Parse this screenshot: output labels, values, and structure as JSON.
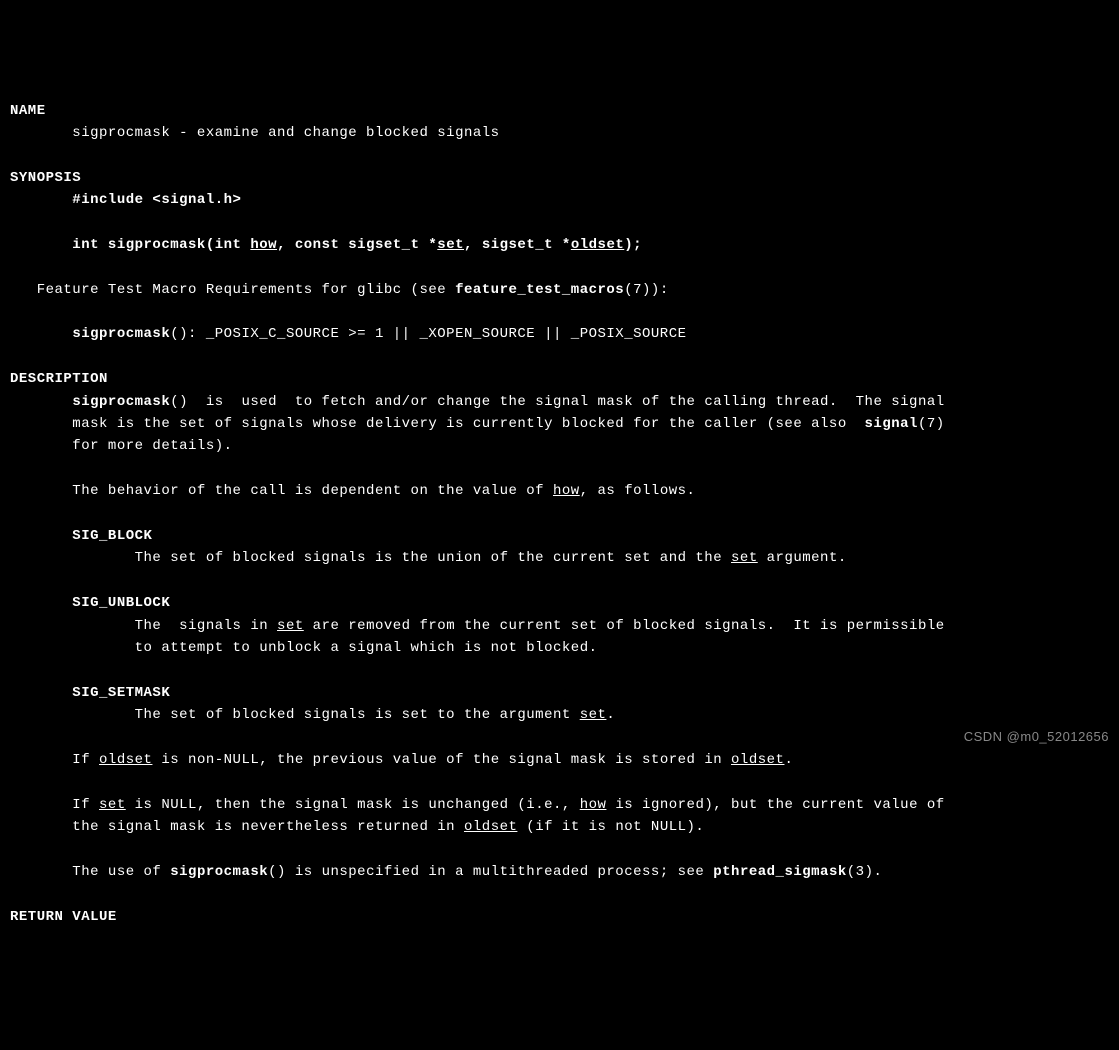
{
  "sections": {
    "name": {
      "header": "NAME",
      "line1": "       sigprocmask - examine and change blocked signals"
    },
    "synopsis": {
      "header": "SYNOPSIS",
      "include": "       #include <signal.h>",
      "decl_pre": "       int sigprocmask(int ",
      "decl_how": "how",
      "decl_mid1": ", const sigset_t *",
      "decl_set": "set",
      "decl_mid2": ", sigset_t *",
      "decl_oldset": "oldset",
      "decl_post": ");",
      "feature_line_pre": "   Feature Test Macro Requirements for glibc (see ",
      "feature_line_bold": "feature_test_macros",
      "feature_line_post": "(7)):",
      "ftm_pre": "       ",
      "ftm_bold": "sigprocmask",
      "ftm_post": "(): _POSIX_C_SOURCE >= 1 || _XOPEN_SOURCE || _POSIX_SOURCE"
    },
    "description": {
      "header": "DESCRIPTION",
      "p1_pre": "       ",
      "p1_bold1": "sigprocmask",
      "p1_mid1": "()  is  used  to fetch and/or change the signal mask of the calling thread.  The signal\n       mask is the set of signals whose delivery is currently blocked for the caller (see also  ",
      "p1_bold2": "signal",
      "p1_post": "(7)\n       for more details).",
      "p2_pre": "       The behavior of the call is dependent on the value of ",
      "p2_how": "how",
      "p2_post": ", as follows.",
      "sigblock_header": "       SIG_BLOCK",
      "sigblock_body_pre": "              The set of blocked signals is the union of the current set and the ",
      "sigblock_set": "set",
      "sigblock_body_post": " argument.",
      "sigunblock_header": "       SIG_UNBLOCK",
      "sigunblock_body_pre": "              The  signals in ",
      "sigunblock_set": "set",
      "sigunblock_body_post": " are removed from the current set of blocked signals.  It is permissible\n              to attempt to unblock a signal which is not blocked.",
      "sigsetmask_header": "       SIG_SETMASK",
      "sigsetmask_body_pre": "              The set of blocked signals is set to the argument ",
      "sigsetmask_set": "set",
      "sigsetmask_body_post": ".",
      "p3_pre": "       If ",
      "p3_oldset1": "oldset",
      "p3_mid": " is non-NULL, the previous value of the signal mask is stored in ",
      "p3_oldset2": "oldset",
      "p3_post": ".",
      "p4_pre": "       If ",
      "p4_set": "set",
      "p4_mid1": " is NULL, then the signal mask is unchanged (i.e., ",
      "p4_how": "how",
      "p4_mid2": " is ignored), but the current value of\n       the signal mask is nevertheless returned in ",
      "p4_oldset": "oldset",
      "p4_post": " (if it is not NULL).",
      "p5_pre": "       The use of ",
      "p5_bold1": "sigprocmask",
      "p5_mid": "() is unspecified in a multithreaded process; see ",
      "p5_bold2": "pthread_sigmask",
      "p5_post": "(3)."
    },
    "return_value": {
      "header": "RETURN VALUE"
    }
  },
  "watermark": "CSDN @m0_52012656"
}
